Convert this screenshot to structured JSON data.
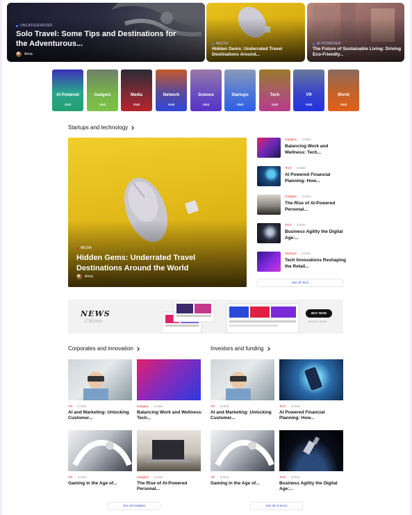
{
  "hero": [
    {
      "category": "Uncategorized",
      "title": "Solo Travel: Some Tips and Destinations for the Adventurous...",
      "author": "Anna"
    },
    {
      "category": "Media",
      "title": "Hidden Gems: Underrated Travel Destinations Around..."
    },
    {
      "category": "AI Powered",
      "title": "The Future of Sustainable Living: Driving Eco-Friendly..."
    }
  ],
  "categories": [
    {
      "label": "AI Powered",
      "visit": "Visit"
    },
    {
      "label": "Gadgets",
      "visit": "Visit"
    },
    {
      "label": "Media",
      "visit": "Visit"
    },
    {
      "label": "Network",
      "visit": "Visit"
    },
    {
      "label": "Science",
      "visit": "Visit"
    },
    {
      "label": "Startups",
      "visit": "Visit"
    },
    {
      "label": "Tech",
      "visit": "Visit"
    },
    {
      "label": "VR",
      "visit": "Visit"
    },
    {
      "label": "World",
      "visit": "Visit"
    }
  ],
  "startups": {
    "heading": "Startups and technology",
    "featured": {
      "category": "Media",
      "title": "Hidden Gems: Underrated Travel Destinations Around the World",
      "author": "Anna"
    },
    "list": [
      {
        "category": "Gadgets",
        "time": "2 mon",
        "title": "Balancing Work and Wellness: Tech..."
      },
      {
        "category": "Tech",
        "time": "3 mon",
        "title": "AI Powered Financial Planning: How..."
      },
      {
        "category": "Gadgets",
        "time": "3 mon",
        "title": "The Rise of AI-Powered Personal..."
      },
      {
        "category": "Tech",
        "time": "3 mon",
        "title": "Business Agility the Digital Age:..."
      },
      {
        "category": "Startups",
        "time": "4 mon",
        "title": "Tech Innovations Reshaping the Retail..."
      }
    ],
    "see_all": "See all Tech"
  },
  "ad": {
    "logo": "NEWS",
    "logo_script": "Citizen",
    "button": "BUY NOW",
    "small": "AD SLOT DEMO"
  },
  "corporates": {
    "heading": "Corporates and innovation",
    "items": [
      {
        "category": "VR",
        "time": "3 mon",
        "title": "AI and Marketing: Unlocking Customer..."
      },
      {
        "category": "Gadgets",
        "time": "2 mon",
        "title": "Balancing Work and Wellness: Tech..."
      },
      {
        "category": "VR",
        "time": "3 mon",
        "title": "Gaming in the Age of..."
      },
      {
        "category": "Gadgets",
        "time": "3 mon",
        "title": "The Rise of AI-Powered Personal..."
      }
    ],
    "see_all": "See all Gadgets"
  },
  "investors": {
    "heading": "Investors and funding",
    "items": [
      {
        "category": "VR",
        "time": "3 mon",
        "title": "AI and Marketing: Unlocking Customer..."
      },
      {
        "category": "Tech",
        "time": "3 mon",
        "title": "AI Powered Financial Planning: How..."
      },
      {
        "category": "VR",
        "time": "3 mon",
        "title": "Gaming in the Age of..."
      },
      {
        "category": "Tech",
        "time": "3 mon",
        "title": "Business Agility the Digital Age:..."
      }
    ],
    "see_all": "See all Science"
  },
  "colors": {
    "accent": "#e0302e",
    "link": "#3557d8",
    "page_bg": "#f3ebfa"
  }
}
